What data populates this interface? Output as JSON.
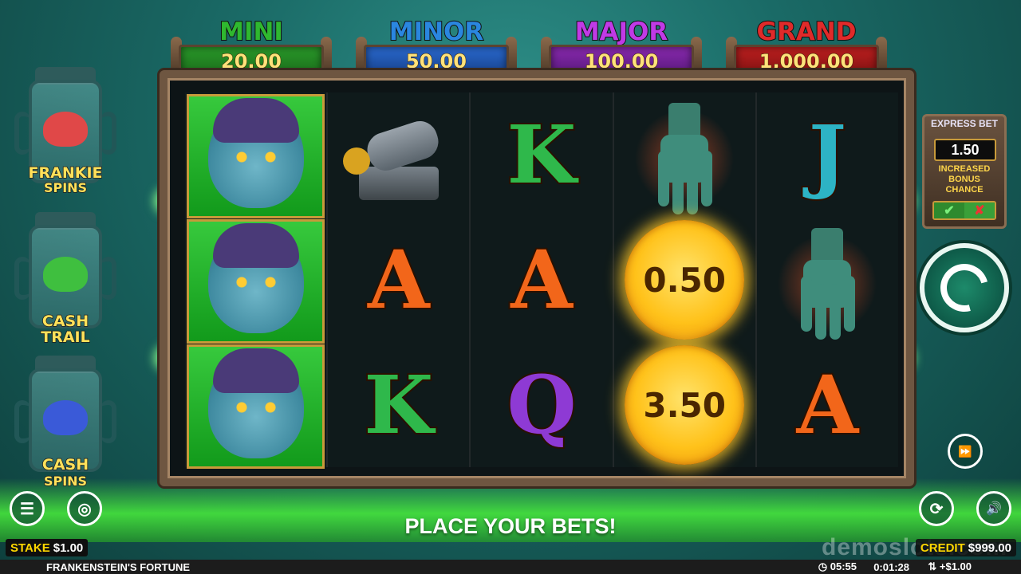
{
  "jackpots": [
    {
      "name": "MINI",
      "value": "20.00",
      "color": "#2fb82f",
      "plate": "#1e7a1e"
    },
    {
      "name": "MINOR",
      "value": "50.00",
      "color": "#2a86e0",
      "plate": "#1a4f9a"
    },
    {
      "name": "MAJOR",
      "value": "100.00",
      "color": "#b02fd6",
      "plate": "#6a1d8a"
    },
    {
      "name": "GRAND",
      "value": "1,000.00",
      "color": "#e02a2a",
      "plate": "#9a1515"
    }
  ],
  "side_features": [
    {
      "label_line1": "FRANKIE",
      "label_line2": "SPINS",
      "brain_color": "#e04040"
    },
    {
      "label_line1": "CASH",
      "label_line2": "TRAIL",
      "brain_color": "#3fbf3f"
    },
    {
      "label_line1": "CASH",
      "label_line2": "SPINS",
      "brain_color": "#3a5ad8"
    }
  ],
  "reels": {
    "reel1": [
      "frankie",
      "frankie",
      "frankie"
    ],
    "reel2": [
      "cannon",
      "A",
      "K"
    ],
    "reel3": [
      "K",
      "A",
      "Q"
    ],
    "reel4": [
      "hand",
      "coin",
      "coin"
    ],
    "reel5": [
      "J",
      "hand",
      "A"
    ],
    "coin_values": [
      "0.50",
      "3.50"
    ]
  },
  "express_bet": {
    "title": "EXPRESS BET",
    "value": "1.50",
    "line1": "INCREASED",
    "line2": "BONUS",
    "line3": "CHANCE",
    "yes": "✔",
    "no": "✘"
  },
  "message": "PLACE YOUR BETS!",
  "stake": {
    "label": "STAKE",
    "value": "$1.00"
  },
  "credit": {
    "label": "CREDIT",
    "value": "$999.00"
  },
  "status": {
    "game_name": "FRANKENSTEIN'S FORTUNE",
    "clock": "05:55",
    "session": "0:01:28",
    "net": "+$1.00"
  },
  "watermark": "demoslots.com",
  "icons": {
    "menu": "☰",
    "coins": "◎",
    "turbo": "⏩",
    "autoplay": "⟳",
    "sound": "🔊"
  }
}
